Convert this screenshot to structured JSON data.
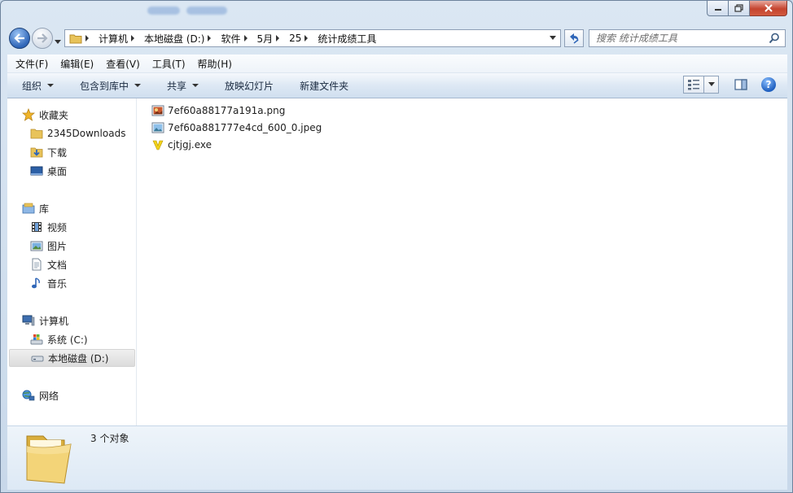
{
  "address": {
    "crumbs": [
      "计算机",
      "本地磁盘 (D:)",
      "软件",
      "5月",
      "25",
      "统计成绩工具"
    ]
  },
  "search": {
    "placeholder": "搜索 统计成绩工具"
  },
  "menu": [
    "文件(F)",
    "编辑(E)",
    "查看(V)",
    "工具(T)",
    "帮助(H)"
  ],
  "toolbar": {
    "organize": "组织",
    "include_library": "包含到库中",
    "share": "共享",
    "slideshow": "放映幻灯片",
    "new_folder": "新建文件夹"
  },
  "nav": {
    "favorites": "收藏夹",
    "fav_items": [
      "2345Downloads",
      "下载",
      "桌面"
    ],
    "libraries": "库",
    "lib_items": [
      "视频",
      "图片",
      "文档",
      "音乐"
    ],
    "computer": "计算机",
    "drives": [
      "系统 (C:)",
      "本地磁盘 (D:)"
    ],
    "network": "网络"
  },
  "files": [
    "7ef60a88177a191a.png",
    "7ef60a881777e4cd_600_0.jpeg",
    "cjtjgj.exe"
  ],
  "status": {
    "count": "3 个对象"
  },
  "colors": {
    "accent": "#2f66b8",
    "selection": "#dcdcdc",
    "close": "#c5442f"
  }
}
